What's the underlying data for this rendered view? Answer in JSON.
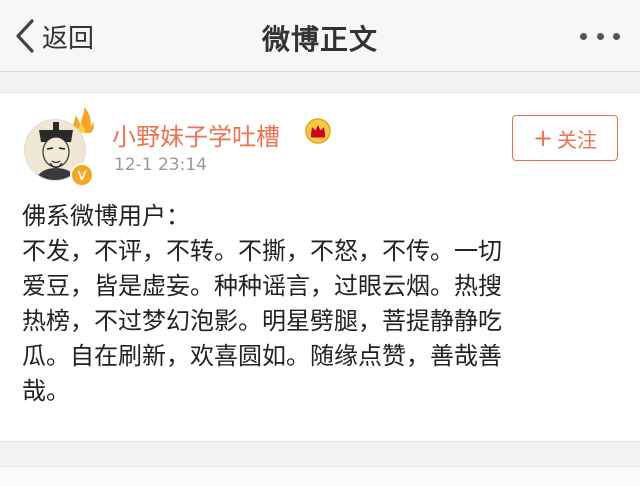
{
  "navbar": {
    "back_label": "返回",
    "title": "微博正文",
    "back_icon": "chevron-left-icon",
    "more_icon": "more-dots-icon"
  },
  "post": {
    "author": "小野妹子学吐槽",
    "timestamp": "12-1 23:14",
    "follow_label": "关注",
    "follow_icon": "plus-icon",
    "verified_badge": "V",
    "accent_color": "#eb7350",
    "lines": [
      "佛系微博用户：",
      "不发，不评，不转。不撕，不怒，不传。一切",
      "爱豆，皆是虚妄。种种谣言，过眼云烟。热搜",
      "热榜，不过梦幻泡影。明星劈腿，菩提静静吃",
      "瓜。自在刷新，欢喜圆如。随缘点赞，善哉善",
      "哉。"
    ]
  }
}
